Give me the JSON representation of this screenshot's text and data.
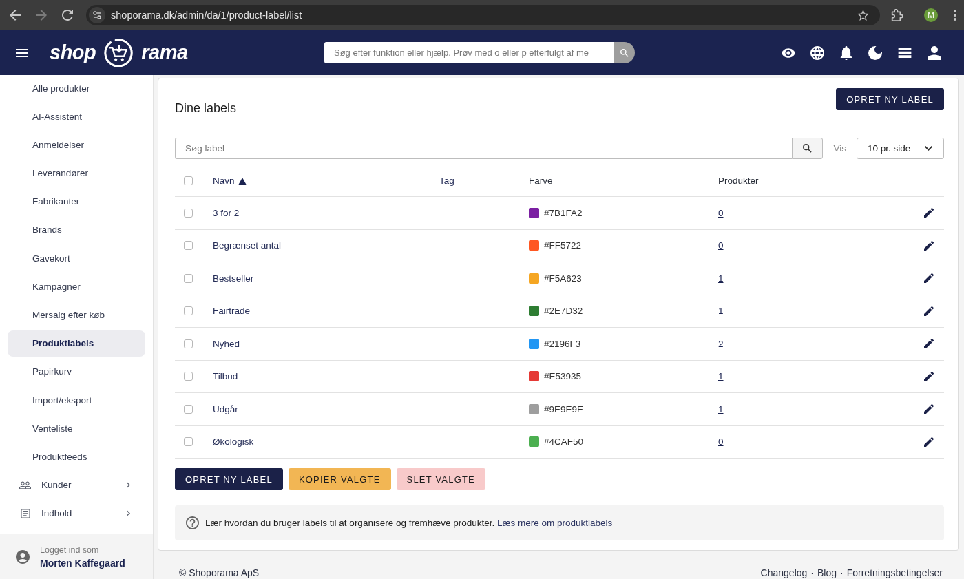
{
  "browser": {
    "url": "shoporama.dk/admin/da/1/product-label/list",
    "profile_initial": "M"
  },
  "header": {
    "logo_left": "shop",
    "logo_right": "rama",
    "search": {
      "placeholder": "Søg efter funktion eller hjælp. Prøv med o eller p efterfulgt af me"
    }
  },
  "sidebar": {
    "items": [
      {
        "label": "Alle produkter",
        "selected": false
      },
      {
        "label": "AI-Assistent",
        "selected": false
      },
      {
        "label": "Anmeldelser",
        "selected": false
      },
      {
        "label": "Leverandører",
        "selected": false
      },
      {
        "label": "Fabrikanter",
        "selected": false
      },
      {
        "label": "Brands",
        "selected": false
      },
      {
        "label": "Gavekort",
        "selected": false
      },
      {
        "label": "Kampagner",
        "selected": false
      },
      {
        "label": "Mersalg efter køb",
        "selected": false
      },
      {
        "label": "Produktlabels",
        "selected": true
      },
      {
        "label": "Papirkurv",
        "selected": false
      },
      {
        "label": "Import/eksport",
        "selected": false
      },
      {
        "label": "Venteliste",
        "selected": false
      },
      {
        "label": "Produktfeeds",
        "selected": false
      }
    ],
    "sections": [
      {
        "label": "Kunder",
        "expanded": false
      },
      {
        "label": "Indhold",
        "expanded": false
      }
    ],
    "user": {
      "caption": "Logget ind som",
      "name": "Morten Kaffegaard"
    }
  },
  "content": {
    "title": "Dine labels",
    "create_button": "OPRET NY LABEL",
    "search": {
      "placeholder": "Søg label"
    },
    "per_page": {
      "label": "Vis",
      "value": "10 pr. side"
    },
    "table": {
      "all_checked": false,
      "columns": [
        {
          "label": "Navn",
          "sortable": true,
          "sorted": true
        },
        {
          "label": "Tag",
          "sortable": true,
          "sorted": false
        },
        {
          "label": "Farve",
          "sortable": false,
          "sorted": false
        },
        {
          "label": "Produkter",
          "sortable": false,
          "sorted": false
        }
      ],
      "rows": [
        {
          "checked": false,
          "name": "3 for 2",
          "color": "#7b1fa2",
          "hex": "#7B1FA2",
          "products": "0"
        },
        {
          "checked": false,
          "name": "Begrænset antal",
          "color": "#ff5722",
          "hex": "#FF5722",
          "products": "0"
        },
        {
          "checked": false,
          "name": "Bestseller",
          "color": "#f5a623",
          "hex": "#F5A623",
          "products": "1"
        },
        {
          "checked": false,
          "name": "Fairtrade",
          "color": "#2e7d32",
          "hex": "#2E7D32",
          "products": "1"
        },
        {
          "checked": false,
          "name": "Nyhed",
          "color": "#2196f3",
          "hex": "#2196F3",
          "products": "2"
        },
        {
          "checked": false,
          "name": "Tilbud",
          "color": "#e53935",
          "hex": "#E53935",
          "products": "1"
        },
        {
          "checked": false,
          "name": "Udgår",
          "color": "#9e9e9e",
          "hex": "#9E9E9E",
          "products": "1"
        },
        {
          "checked": false,
          "name": "Økologisk",
          "color": "#4caf50",
          "hex": "#4CAF50",
          "products": "0"
        }
      ]
    },
    "actions": [
      {
        "label": "OPRET NY LABEL",
        "kind": "primary"
      },
      {
        "label": "KOPIER VALGTE",
        "kind": "warning"
      },
      {
        "label": "SLET VALGTE",
        "kind": "danger"
      }
    ],
    "info": {
      "text": "Lær hvordan du bruger labels til at organisere og fremhæve produkter.",
      "link": "Læs mere om produktlabels"
    }
  },
  "footer": {
    "copyright": "© Shoporama ApS",
    "links": [
      "Changelog",
      "Blog",
      "Forretningsbetingelser"
    ],
    "separator": "·"
  }
}
